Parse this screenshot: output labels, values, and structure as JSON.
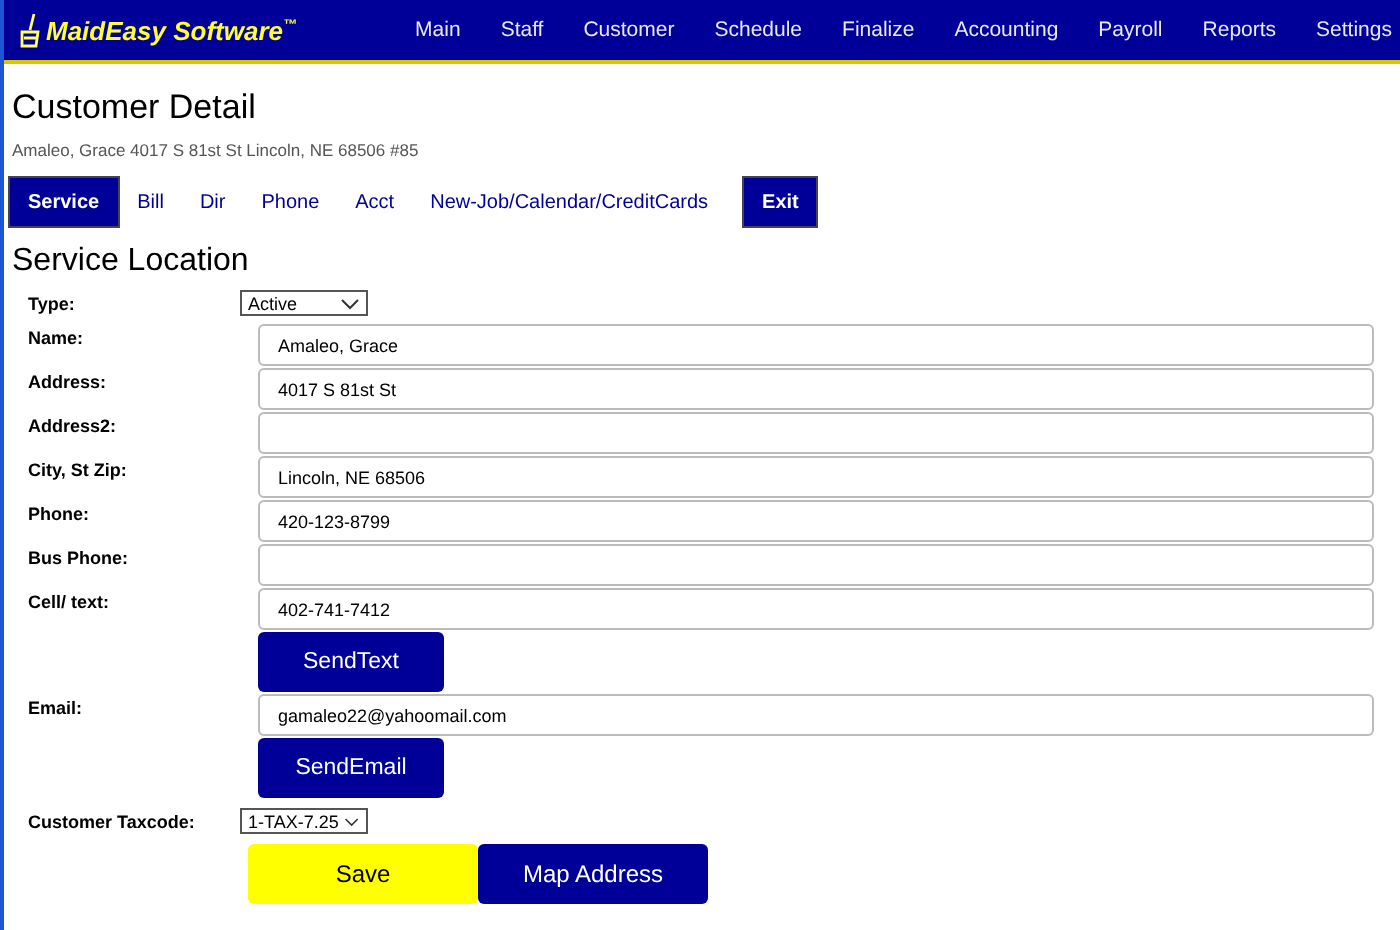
{
  "nav": {
    "logo": "MaidEasy Software$^{™}$",
    "items": [
      "Main",
      "Staff",
      "Customer",
      "Schedule",
      "Finalize",
      "Accounting",
      "Payroll",
      "Reports",
      "Settings"
    ]
  },
  "page": {
    "title": "Customer Detail",
    "summary": "Amaleo, Grace 4017 S 81st St Lincoln, NE 68506 #85"
  },
  "tabs": [
    {
      "label": "Service",
      "selected": true
    },
    {
      "label": "Bill",
      "selected": false
    },
    {
      "label": "Dir",
      "selected": false
    },
    {
      "label": "Phone",
      "selected": false
    },
    {
      "label": "Acct",
      "selected": false
    },
    {
      "label": "New-Job/Calendar/CreditCards",
      "selected": false
    },
    {
      "label": "Exit",
      "selected": true
    }
  ],
  "section": {
    "title": "Service Location"
  },
  "rows": [
    {
      "kind": "select",
      "label": "Type:",
      "value": "Active"
    },
    {
      "kind": "input",
      "label": "Name:",
      "value": "Amaleo, Grace"
    },
    {
      "kind": "input",
      "label": "Address:",
      "value": "4017 S 81st St"
    },
    {
      "kind": "input",
      "label": "Address2:"
    },
    {
      "kind": "input",
      "label": "City, St Zip:",
      "value": "Lincoln, NE 68506"
    },
    {
      "kind": "input",
      "label": "Phone:",
      "value": "420-123-8799"
    },
    {
      "kind": "input",
      "label": "Bus Phone:"
    },
    {
      "kind": "input",
      "label": "Cell/ text:",
      "value": "402-741-7412"
    },
    {
      "kind": "button",
      "value": "SendText"
    },
    {
      "kind": "input",
      "label": "Email:",
      "value": "gamaleo22@yahoomail.com"
    },
    {
      "kind": "button",
      "value": "SendEmail"
    },
    {
      "kind": "select",
      "label": "Customer Taxcode:",
      "value": "1-TAX-7.25"
    }
  ],
  "actions": [
    {
      "label": "Save",
      "kind": "highlight"
    },
    {
      "label": "Map Address",
      "kind": "primary"
    }
  ]
}
